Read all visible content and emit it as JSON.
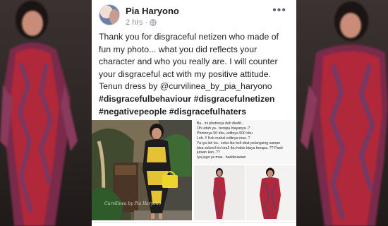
{
  "post": {
    "author": "Pia Haryono",
    "time": "2 hrs",
    "separator": "·",
    "more_label": "•••",
    "text": "Thank you for disgraceful netizen who made of fun my photo... what you did reflects your character and who you really are. I will counter your disgraceful act with my positive attitude. Tenun dress by @curvilinea_by_pia_haryono",
    "hashtags": [
      "#disgracefulbehaviour",
      "#disgracefulnetizen",
      "#negativepeople",
      "#disgracefulhaters"
    ]
  },
  "photos": {
    "main_watermark": "Curvilinea by Pia Haryono",
    "chat_lines": [
      "Bu.. ini photonya dah diedit...",
      "Oh udah ya.. berapa biayanya..?",
      "Photonya 50 ribu, editnya 500 ribu",
      "Loh..!! Kok mahal editnya mas..?",
      "Ya iya lah bu.. coba ibu beli obat pelangsing sampe",
      "bisa sekecil itu kira2 ibu habis biaya berapa..?? Pasti",
      "jutaan kan..??",
      "Iya juga ya mas.. haddeuwww"
    ]
  },
  "colors": {
    "card_bg": "#ffffff",
    "text_primary": "#1c1e21",
    "text_secondary": "#8d949e",
    "backdrop": "#2b2726",
    "dress_red": "#b0283a",
    "dress_lace": "#6d3b6a"
  },
  "icons": {
    "globe": "globe-icon",
    "more": "more-options-icon"
  }
}
